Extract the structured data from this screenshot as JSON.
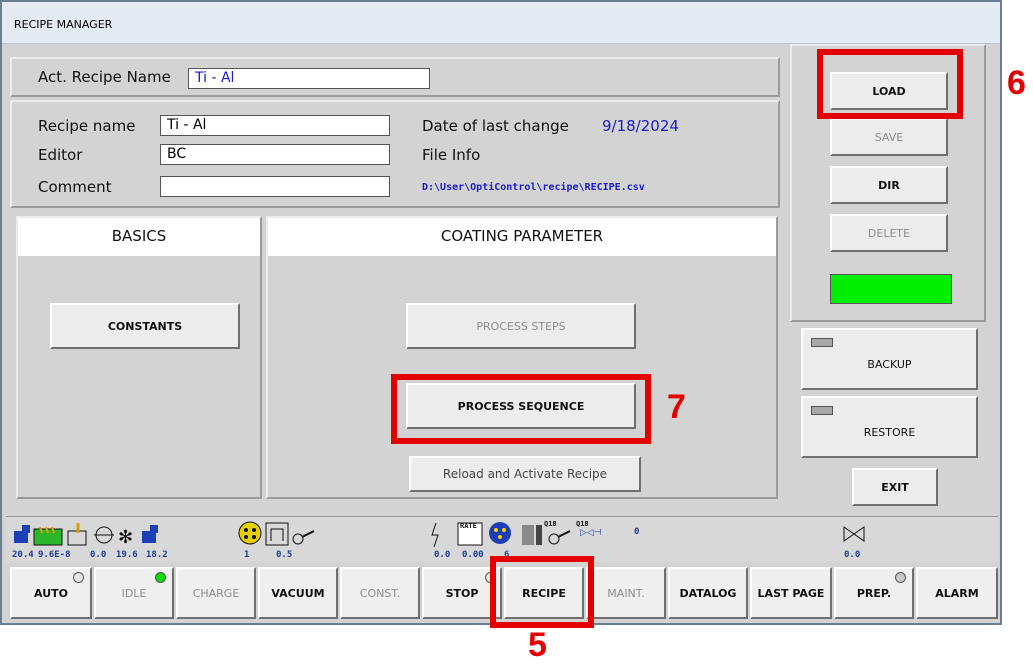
{
  "window": {
    "title": "RECIPE MANAGER"
  },
  "recipe": {
    "act_label": "Act. Recipe Name",
    "act_value": "Ti - Al",
    "name_label": "Recipe name",
    "name_value": "Ti - Al",
    "editor_label": "Editor",
    "editor_value": "BC",
    "comment_label": "Comment",
    "comment_value": "",
    "date_label": "Date of last change",
    "date_value": "9/18/2024",
    "fileinfo_label": "File Info",
    "path_value": "D:\\User\\OptiControl\\recipe\\RECIPE.csv"
  },
  "sections": {
    "basics": "BASICS",
    "coating": "COATING PARAMETER"
  },
  "buttons": {
    "constants": "CONSTANTS",
    "process_steps": "PROCESS STEPS",
    "process_sequence": "PROCESS SEQUENCE",
    "reload": "Reload and Activate Recipe",
    "load": "LOAD",
    "save": "SAVE",
    "dir": "DIR",
    "delete": "DELETE",
    "backup": "BACKUP",
    "restore": "RESTORE",
    "exit": "EXIT"
  },
  "status": {
    "v1": "20.4",
    "v2": "9.6E-8",
    "v3": "0.0",
    "v4": "19.6",
    "v5": "18.2",
    "v6": "1",
    "v7": "0.5",
    "v8": "0.0",
    "v9": "0.00",
    "v10": "6",
    "q1": "Q18",
    "q2": "Q18",
    "v11": "0",
    "v12": "0.0",
    "rate_label": "RATE"
  },
  "nav": {
    "auto": "AUTO",
    "idle": "IDLE",
    "charge": "CHARGE",
    "vacuum": "VACUUM",
    "const": "CONST.",
    "stop": "STOP",
    "recipe": "RECIPE",
    "maint": "MAINT.",
    "datalog": "DATALOG",
    "lastpage": "LAST PAGE",
    "prep": "PREP.",
    "alarm": "ALARM"
  },
  "callouts": {
    "c5": "5",
    "c6": "6",
    "c7": "7"
  },
  "colors": {
    "highlight": "#e40000",
    "status_ok": "#00ee00",
    "value_blue": "#1a1acc"
  }
}
